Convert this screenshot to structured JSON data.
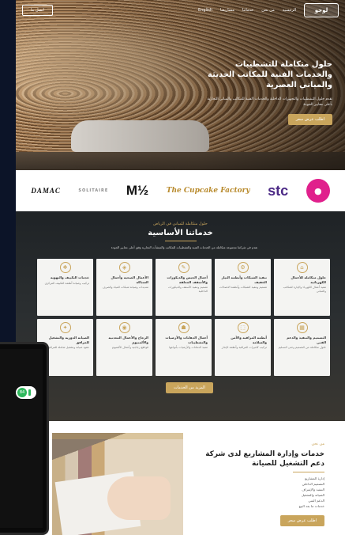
{
  "nav": {
    "logo": "لوجو",
    "items": [
      "الرئيسية",
      "من نحن",
      "خدماتنا",
      "مشاريعنا",
      "English"
    ],
    "cta": "اتصل بنا"
  },
  "hero": {
    "title": "حلول متكاملة للتشطيبات والخدمات الفنية للمكاتب الحديثة والمباني العصرية",
    "paragraph": "نقدم حلول التشطيبات والتجهيزات الداخلية والخدمات الفنية للمكاتب والمباني التجارية بأعلى معايير الجودة",
    "button": "اطلب عرض سعر"
  },
  "clients": [
    "DAMAC",
    "SOLITAIRE",
    "½M",
    "The Cupcake Factory",
    "stc",
    "●"
  ],
  "services": {
    "subtitle": "حلول متكاملة للمباني في الرياض",
    "title": "خدماتنا الأساسية",
    "intro": "نقدم في شركتنا مجموعة متكاملة من الخدمات الفنية والتشطيبات للمكاتب والمنشآت التجارية وفق أعلى معايير الجودة",
    "cards": [
      {
        "icon": "⌂",
        "title": "حلول متكاملة للأعمال الكهربائية",
        "desc": "تنفيذ أعمال الكهرباء والإنارة للمكاتب والمباني"
      },
      {
        "icon": "⚙",
        "title": "تنفيذ الشبكات وأنظمة التيار الخفيف",
        "desc": "تصميم وتنفيذ الشبكات وأنظمة الاتصالات"
      },
      {
        "icon": "✎",
        "title": "أعمال الجبس والديكورات والأسقف المعلقة",
        "desc": "تصميم وتنفيذ الأسقف والديكورات الداخلية"
      },
      {
        "icon": "◈",
        "title": "الأعمال الصحية وأعمال السباكة",
        "desc": "تمديدات وصيانة شبكات المياه والصرف"
      },
      {
        "icon": "❖",
        "title": "خدمات التكييف والتهوية",
        "desc": "تركيب وصيانة أنظمة التكييف المركزي"
      },
      {
        "icon": "▦",
        "title": "التصميم والتنفيذ والدعم الفني",
        "desc": "حلول متكاملة من التصميم وحتى التسليم"
      },
      {
        "icon": "⬚",
        "title": "أنظمة المراقبة والأمن والسلامة",
        "desc": "تركيب كاميرات المراقبة وأنظمة الإنذار"
      },
      {
        "icon": "☗",
        "title": "أعمال الدهانات والأرضيات والتشطيبات",
        "desc": "تنفيذ الدهانات والأرضيات بأنواعها"
      },
      {
        "icon": "◉",
        "title": "الزجاج والأعمال المعدنية والألمنيوم",
        "desc": "قواطع زجاجية وأعمال الألمنيوم"
      },
      {
        "icon": "✦",
        "title": "الصيانة الدورية والتشغيل للمرافق",
        "desc": "عقود صيانة وتشغيل شاملة للمرافق"
      }
    ],
    "more_button": "المزيد من الخدمات"
  },
  "project": {
    "subtitle": "من نحن",
    "title": "خدمات وإدارة المشاريع لدى شركة دعم التشغيل للصيانة",
    "list": [
      "إدارة المشاريع",
      "التصميم الداخلي",
      "التنفيذ والإشراف",
      "الصيانة والتشغيل",
      "الدعم الفني",
      "خدمات ما بعد البيع"
    ],
    "button": "اطلب عرض سعر"
  },
  "badge": {
    "value": "84"
  },
  "colors": {
    "accent": "#c9a55c",
    "dark": "#0d1530",
    "card": "#f4f4f2"
  }
}
